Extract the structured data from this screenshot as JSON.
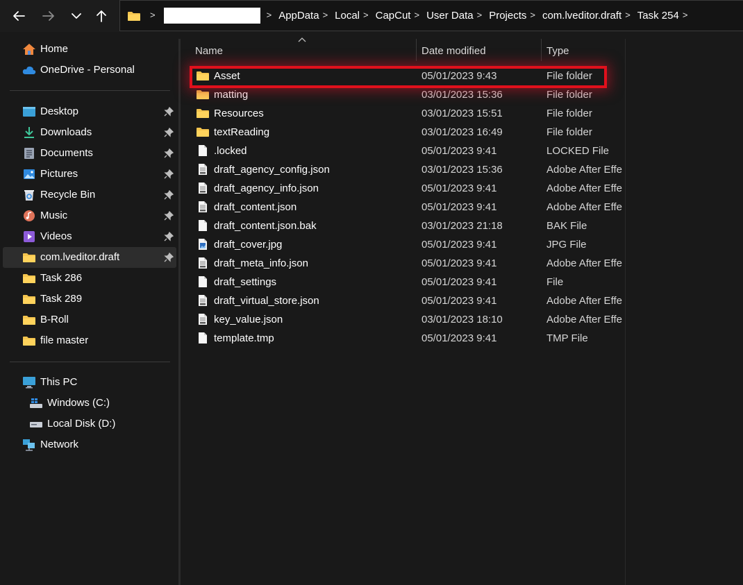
{
  "address_bar": {
    "crumbs": [
      "AppData",
      "Local",
      "CapCut",
      "User Data",
      "Projects",
      "com.lveditor.draft",
      "Task 254"
    ]
  },
  "sidebar": {
    "quick": [
      {
        "label": "Home",
        "icon": "home-icon"
      },
      {
        "label": "OneDrive - Personal",
        "icon": "onedrive-icon"
      }
    ],
    "pinned": [
      {
        "label": "Desktop",
        "icon": "desktop-icon",
        "pinned": true
      },
      {
        "label": "Downloads",
        "icon": "downloads-icon",
        "pinned": true
      },
      {
        "label": "Documents",
        "icon": "documents-icon",
        "pinned": true
      },
      {
        "label": "Pictures",
        "icon": "pictures-icon",
        "pinned": true
      },
      {
        "label": "Recycle Bin",
        "icon": "recycle-bin-icon",
        "pinned": true
      },
      {
        "label": "Music",
        "icon": "music-icon",
        "pinned": true
      },
      {
        "label": "Videos",
        "icon": "videos-icon",
        "pinned": true
      },
      {
        "label": "com.lveditor.draft",
        "icon": "folder-icon",
        "pinned": true,
        "selected": true
      },
      {
        "label": "Task 286",
        "icon": "folder-icon"
      },
      {
        "label": "Task 289",
        "icon": "folder-icon"
      },
      {
        "label": "B-Roll",
        "icon": "folder-icon"
      },
      {
        "label": "file master",
        "icon": "folder-icon"
      }
    ],
    "system": [
      {
        "label": "This PC",
        "icon": "this-pc-icon"
      },
      {
        "label": "Windows (C:)",
        "icon": "windows-drive-icon"
      },
      {
        "label": "Local Disk (D:)",
        "icon": "local-disk-icon"
      },
      {
        "label": "Network",
        "icon": "network-icon"
      }
    ]
  },
  "columns": {
    "name": "Name",
    "date": "Date modified",
    "type": "Type"
  },
  "files": [
    {
      "name": "Asset",
      "date": "05/01/2023 9:43",
      "type": "File folder",
      "kind": "folder"
    },
    {
      "name": "matting",
      "date": "03/01/2023 15:36",
      "type": "File folder",
      "kind": "folder"
    },
    {
      "name": "Resources",
      "date": "03/01/2023 15:51",
      "type": "File folder",
      "kind": "folder"
    },
    {
      "name": "textReading",
      "date": "03/01/2023 16:49",
      "type": "File folder",
      "kind": "folder"
    },
    {
      "name": ".locked",
      "date": "05/01/2023 9:41",
      "type": "LOCKED File",
      "kind": "blank"
    },
    {
      "name": "draft_agency_config.json",
      "date": "03/01/2023 15:36",
      "type": "Adobe After Effe",
      "kind": "json"
    },
    {
      "name": "draft_agency_info.json",
      "date": "05/01/2023 9:41",
      "type": "Adobe After Effe",
      "kind": "json"
    },
    {
      "name": "draft_content.json",
      "date": "05/01/2023 9:41",
      "type": "Adobe After Effe",
      "kind": "json"
    },
    {
      "name": "draft_content.json.bak",
      "date": "03/01/2023 21:18",
      "type": "BAK File",
      "kind": "blank"
    },
    {
      "name": "draft_cover.jpg",
      "date": "05/01/2023 9:41",
      "type": "JPG File",
      "kind": "image"
    },
    {
      "name": "draft_meta_info.json",
      "date": "05/01/2023 9:41",
      "type": "Adobe After Effe",
      "kind": "json"
    },
    {
      "name": "draft_settings",
      "date": "05/01/2023 9:41",
      "type": "File",
      "kind": "blank"
    },
    {
      "name": "draft_virtual_store.json",
      "date": "05/01/2023 9:41",
      "type": "Adobe After Effe",
      "kind": "json"
    },
    {
      "name": "key_value.json",
      "date": "03/01/2023 18:10",
      "type": "Adobe After Effe",
      "kind": "json"
    },
    {
      "name": "template.tmp",
      "date": "05/01/2023 9:41",
      "type": "TMP File",
      "kind": "blank"
    }
  ],
  "highlight": {
    "target": "Asset",
    "color": "#e0101c"
  }
}
